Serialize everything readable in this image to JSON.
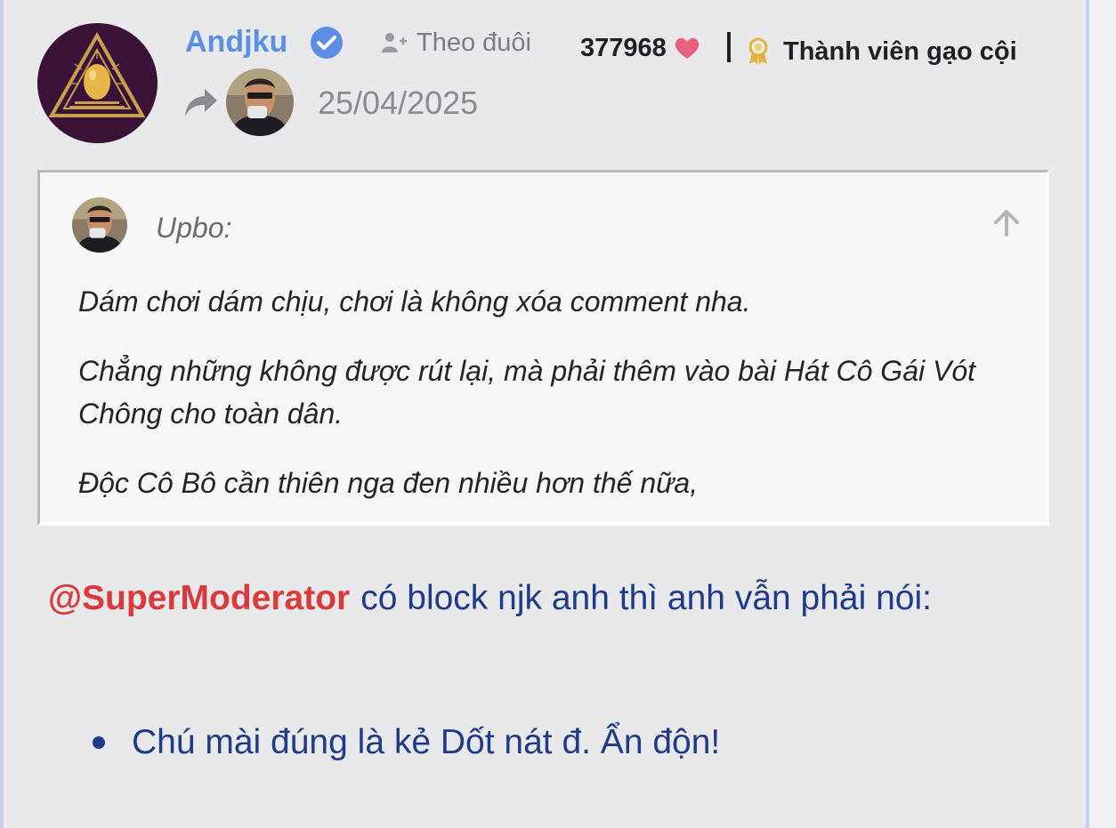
{
  "post": {
    "author": "Andjku",
    "follow_label": "Theo đuôi",
    "likes": "377968",
    "rank": "Thành viên gạo cội",
    "date": "25/04/2025"
  },
  "quote": {
    "author": "Upbo:",
    "lines": [
      "Dám chơi dám chịu, chơi là không xóa comment nha.",
      "Chẳng những không được rút lại, mà phải thêm vào bài Hát Cô Gái Vót Chông cho toàn dân.",
      "Độc Cô Bô cần thiên nga đen nhiều hơn thế nữa,"
    ]
  },
  "content": {
    "mention": "@SuperModerator",
    "text": "có block njk anh thì anh vẫn phải nói:",
    "bullets": [
      "Chú mài đúng là kẻ Dốt nát đ. Ẩn độn!"
    ]
  },
  "colors": {
    "username": "#5b8fe6",
    "mention": "#d93a3a",
    "body_text": "#1e3a8a",
    "heart": "#e8627f",
    "badge": "#e0b43a"
  },
  "icons": [
    "verified-badge-icon",
    "user-plus-icon",
    "heart-icon",
    "award-icon",
    "share-icon",
    "arrow-up-icon"
  ]
}
